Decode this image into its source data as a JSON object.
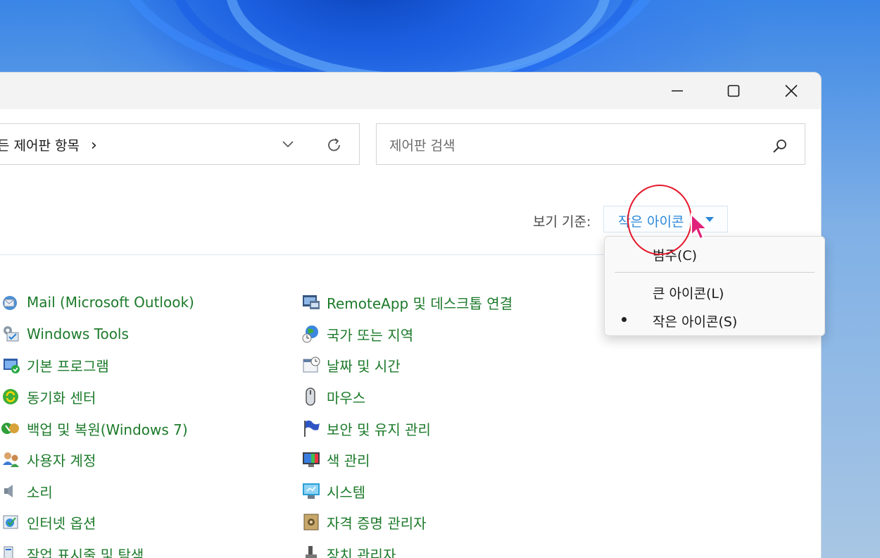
{
  "breadcrumb": {
    "text": "든 제어판 항목",
    "chevron": "›"
  },
  "search": {
    "placeholder": "제어판 검색"
  },
  "view": {
    "label": "보기 기준:",
    "current": "작은 아이콘"
  },
  "view_menu": {
    "items": [
      {
        "label": "범주(C)",
        "selected": false
      },
      {
        "label": "큰 아이콘(L)",
        "selected": false
      },
      {
        "label": "작은 아이콘(S)",
        "selected": true
      }
    ]
  },
  "items_left": [
    {
      "label": "Mail (Microsoft Outlook)",
      "icon": "mail-icon"
    },
    {
      "label": "Windows Tools",
      "icon": "windows-tools-icon"
    },
    {
      "label": "기본 프로그램",
      "icon": "default-programs-icon"
    },
    {
      "label": "동기화 센터",
      "icon": "sync-center-icon"
    },
    {
      "label": "백업 및 복원(Windows 7)",
      "icon": "backup-icon"
    },
    {
      "label": "사용자 계정",
      "icon": "user-accounts-icon"
    },
    {
      "label": "소리",
      "icon": "sound-icon"
    },
    {
      "label": "인터넷 옵션",
      "icon": "internet-options-icon"
    },
    {
      "label": "작업 표시줄 및 탐색",
      "icon": "taskbar-icon"
    }
  ],
  "items_right": [
    {
      "label": "RemoteApp 및 데스크톱 연결",
      "icon": "remoteapp-icon"
    },
    {
      "label": "국가 또는 지역",
      "icon": "region-icon"
    },
    {
      "label": "날짜 및 시간",
      "icon": "date-time-icon"
    },
    {
      "label": "마우스",
      "icon": "mouse-icon"
    },
    {
      "label": "보안 및 유지 관리",
      "icon": "security-flag-icon"
    },
    {
      "label": "색 관리",
      "icon": "color-management-icon"
    },
    {
      "label": "시스템",
      "icon": "system-icon"
    },
    {
      "label": "자격 증명 관리자",
      "icon": "credential-manager-icon"
    },
    {
      "label": "장치 관리자",
      "icon": "device-manager-icon"
    }
  ],
  "colors": {
    "link": "#1c7a2a",
    "accent": "#2b88d8",
    "highlight": "#e5172a"
  }
}
